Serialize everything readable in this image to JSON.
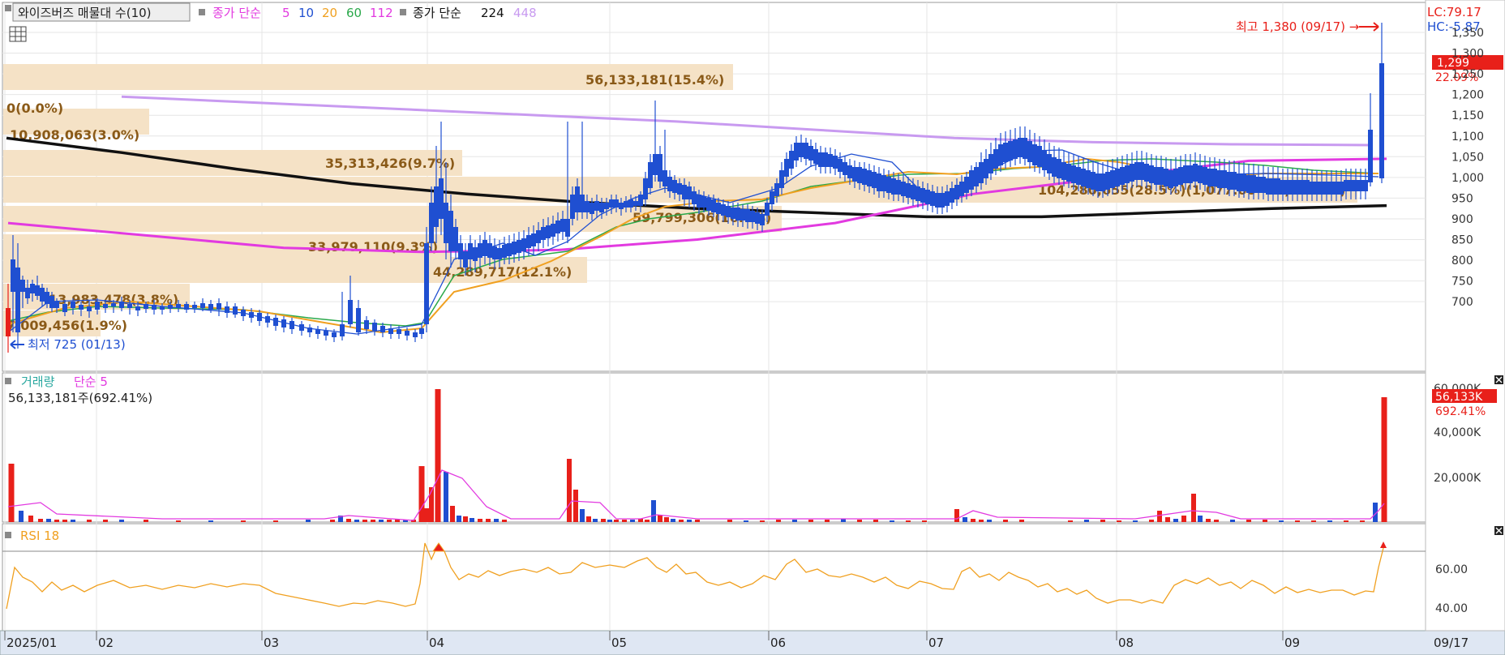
{
  "header": {
    "indicator_label": "와이즈버즈 매물대 수(10)",
    "ma_group1_label": "종가 단순",
    "ma_group1_periods": [
      "5",
      "10",
      "20",
      "60",
      "112"
    ],
    "ma_group2_label": "종가 단순",
    "ma_group2_periods": [
      "224",
      "448"
    ]
  },
  "price_panel": {
    "lc_label": "LC:79.17",
    "hc_label": "HC:-5.87",
    "high_note": "최고 1,380 (09/17) →",
    "low_note": "최저 725 (01/13)",
    "last_price_tag": "1,299",
    "last_change_tag": "22.09%",
    "y_ticks": [
      "1,350",
      "1,300",
      "1,250",
      "1,200",
      "1,150",
      "1,100",
      "1,050",
      "1,000",
      "950",
      "900",
      "850",
      "800",
      "750",
      "700"
    ],
    "volume_profile_labels": [
      "56,133,181(15.4%)",
      "0(0.0%)",
      "10,908,063(3.0%)",
      "35,313,426(9.7%)",
      "33,979,110(9.3%)",
      "44,289,717(12.1%)",
      "59,799,306(16.4%)",
      "104,280,655(28.5%)(1,077.00 ~ 1,021.00)",
      "13,983,478(3.8%)",
      "7,009,456(1.9%)"
    ]
  },
  "volume_panel": {
    "title": "거래량",
    "ma_label": "단순 5",
    "info": "56,133,181주(692.41%)",
    "y_ticks": [
      "60,000K",
      "40,000K",
      "20,000K"
    ],
    "last_volume_tag": "56,133K",
    "last_ratio_tag": "692.41%"
  },
  "rsi_panel": {
    "title": "RSI 18",
    "y_ticks": [
      "60.00",
      "40.00"
    ]
  },
  "x_axis": {
    "labels": [
      "2025/01",
      "02",
      "03",
      "04",
      "05",
      "06",
      "07",
      "08",
      "09"
    ],
    "last_date": "09/17"
  },
  "colors": {
    "up": "#e8201a",
    "down": "#1f4fd1",
    "ma5": "#ff2fb0",
    "ma10": "#1f4fd1",
    "ma20": "#f0a020",
    "ma60": "#2aa84a",
    "ma112": "#e23ae0",
    "ma224": "#111111",
    "ma448": "#c89af0",
    "profile": "#f5e2c6",
    "profile_text": "#8a5a18",
    "rsi": "#f0a020",
    "vol_ma": "#e23ae0"
  },
  "chart_data": {
    "type": "candlestick",
    "x": [
      "2025/01",
      "02",
      "03",
      "04",
      "05",
      "06",
      "07",
      "08",
      "09"
    ],
    "ylim": [
      700,
      1350
    ],
    "series": [
      {
        "name": "종가 단순 224",
        "values": [
          1095,
          1060,
          1020,
          985,
          960,
          940,
          925,
          915,
          905,
          905,
          915,
          925,
          932
        ]
      },
      {
        "name": "종가 단순 448",
        "values": [
          1195,
          1180,
          1165,
          1150,
          1135,
          1115,
          1095,
          1085,
          1080,
          1078
        ]
      },
      {
        "name": "종가 단순 112",
        "values": [
          890,
          860,
          830,
          820,
          825,
          850,
          890,
          960,
          1000,
          1040,
          1045
        ]
      }
    ],
    "high": {
      "value": 1380,
      "date": "09/17"
    },
    "low": {
      "value": 725,
      "date": "01/13"
    },
    "last": {
      "close": 1299,
      "change_pct": 22.09,
      "volume": 56133181,
      "volume_ratio_pct": 692.41
    }
  }
}
